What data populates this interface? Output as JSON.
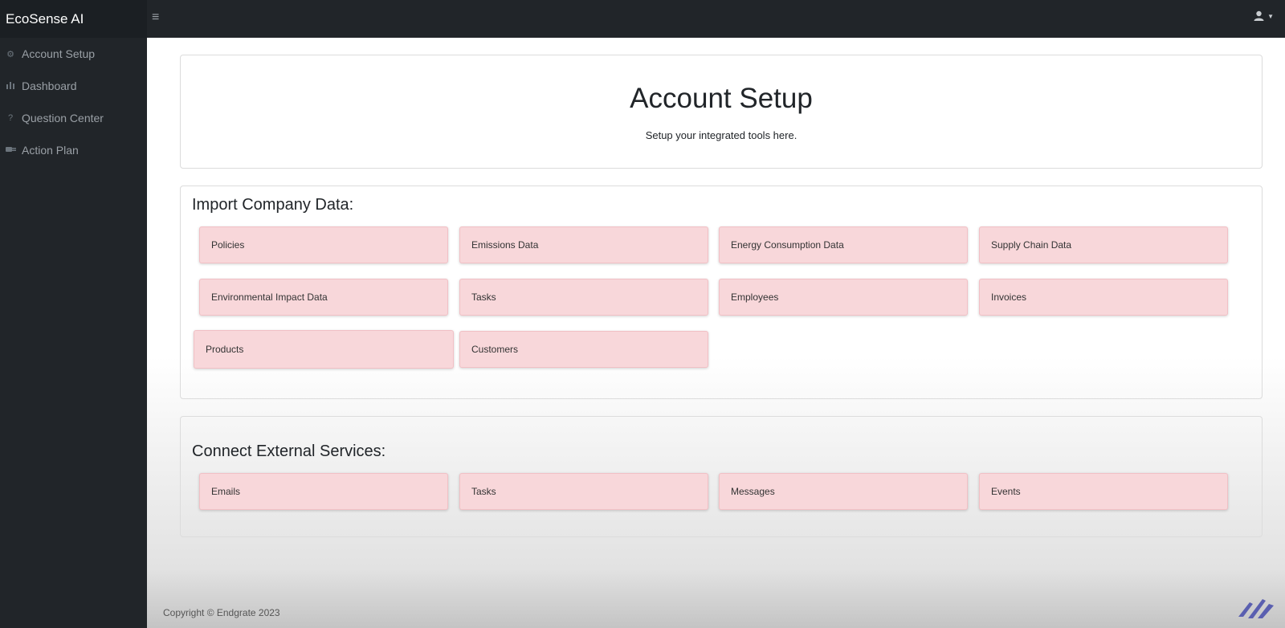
{
  "app": {
    "brand": "EcoSense AI"
  },
  "sidebar": {
    "items": [
      {
        "label": "Account Setup",
        "icon": "gear-icon"
      },
      {
        "label": "Dashboard",
        "icon": "bar-chart-icon"
      },
      {
        "label": "Question Center",
        "icon": "question-icon"
      },
      {
        "label": "Action Plan",
        "icon": "plug-icon"
      }
    ]
  },
  "topbar": {
    "menu_icon": "hamburger-icon",
    "user_icon": "user-icon"
  },
  "hero": {
    "title": "Account Setup",
    "subtitle": "Setup your integrated tools here."
  },
  "import_section": {
    "title": "Import Company Data:",
    "tiles": [
      "Policies",
      "Emissions Data",
      "Energy Consumption Data",
      "Supply Chain Data",
      "Environmental Impact Data",
      "Tasks",
      "Employees",
      "Invoices",
      "Products",
      "Customers"
    ]
  },
  "connect_section": {
    "title": "Connect External Services:",
    "tiles": [
      "Emails",
      "Tasks",
      "Messages",
      "Events"
    ]
  },
  "footer": {
    "copyright": "Copyright © Endgrate 2023"
  },
  "colors": {
    "sidebar_bg": "#212529",
    "tile_bg": "#f8d7da",
    "logo": "#5a5fb0"
  }
}
